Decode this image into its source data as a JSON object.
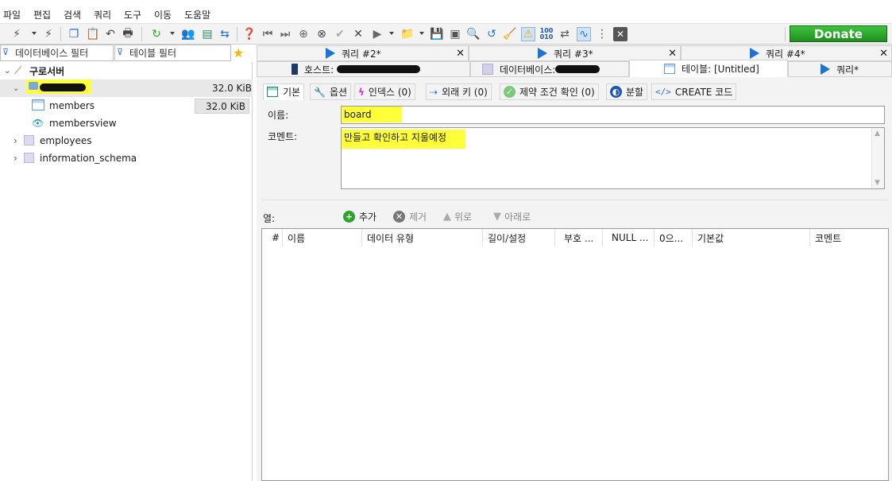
{
  "menu": [
    "파일",
    "편집",
    "검색",
    "쿼리",
    "도구",
    "이동",
    "도움말"
  ],
  "toolbar": {
    "donate_label": "Donate"
  },
  "filters": {
    "database_filter": "데이터베이스 필터",
    "table_filter": "테이블 필터"
  },
  "tree": {
    "server": "구로서버",
    "database_size": "32.0 KiB",
    "items": [
      {
        "label": "members",
        "size": "32.0 KiB"
      },
      {
        "label": "membersview"
      },
      {
        "label": "employees"
      },
      {
        "label": "information_schema"
      }
    ]
  },
  "query_tabs": [
    "쿼리 #2*",
    "쿼리 #3*",
    "쿼리 #4*"
  ],
  "second_tabs": {
    "host": "호스트:",
    "database": "데이터베이스:",
    "table": "테이블: [Untitled]",
    "query": "쿼리*"
  },
  "sub_tabs": [
    "기본",
    "옵션",
    "인덱스 (0)",
    "외래 키 (0)",
    "제약 조건 확인 (0)",
    "분할",
    "CREATE 코드"
  ],
  "form": {
    "name_label": "이름:",
    "name_value": "board",
    "comment_label": "코멘트:",
    "comment_value": "만들고 확인하고 지울예정"
  },
  "columns": {
    "label": "열:",
    "buttons": [
      "추가",
      "제거",
      "위로",
      "아래로"
    ],
    "headers": [
      "#",
      "이름",
      "데이터 유형",
      "길이/설정",
      "부호 ...",
      "NULL ...",
      "0으...",
      "기본값",
      "코멘트"
    ]
  },
  "colors": {
    "accent": "#1a73d9",
    "highlight": "#ffff3a",
    "donate": "#2aa52a"
  }
}
